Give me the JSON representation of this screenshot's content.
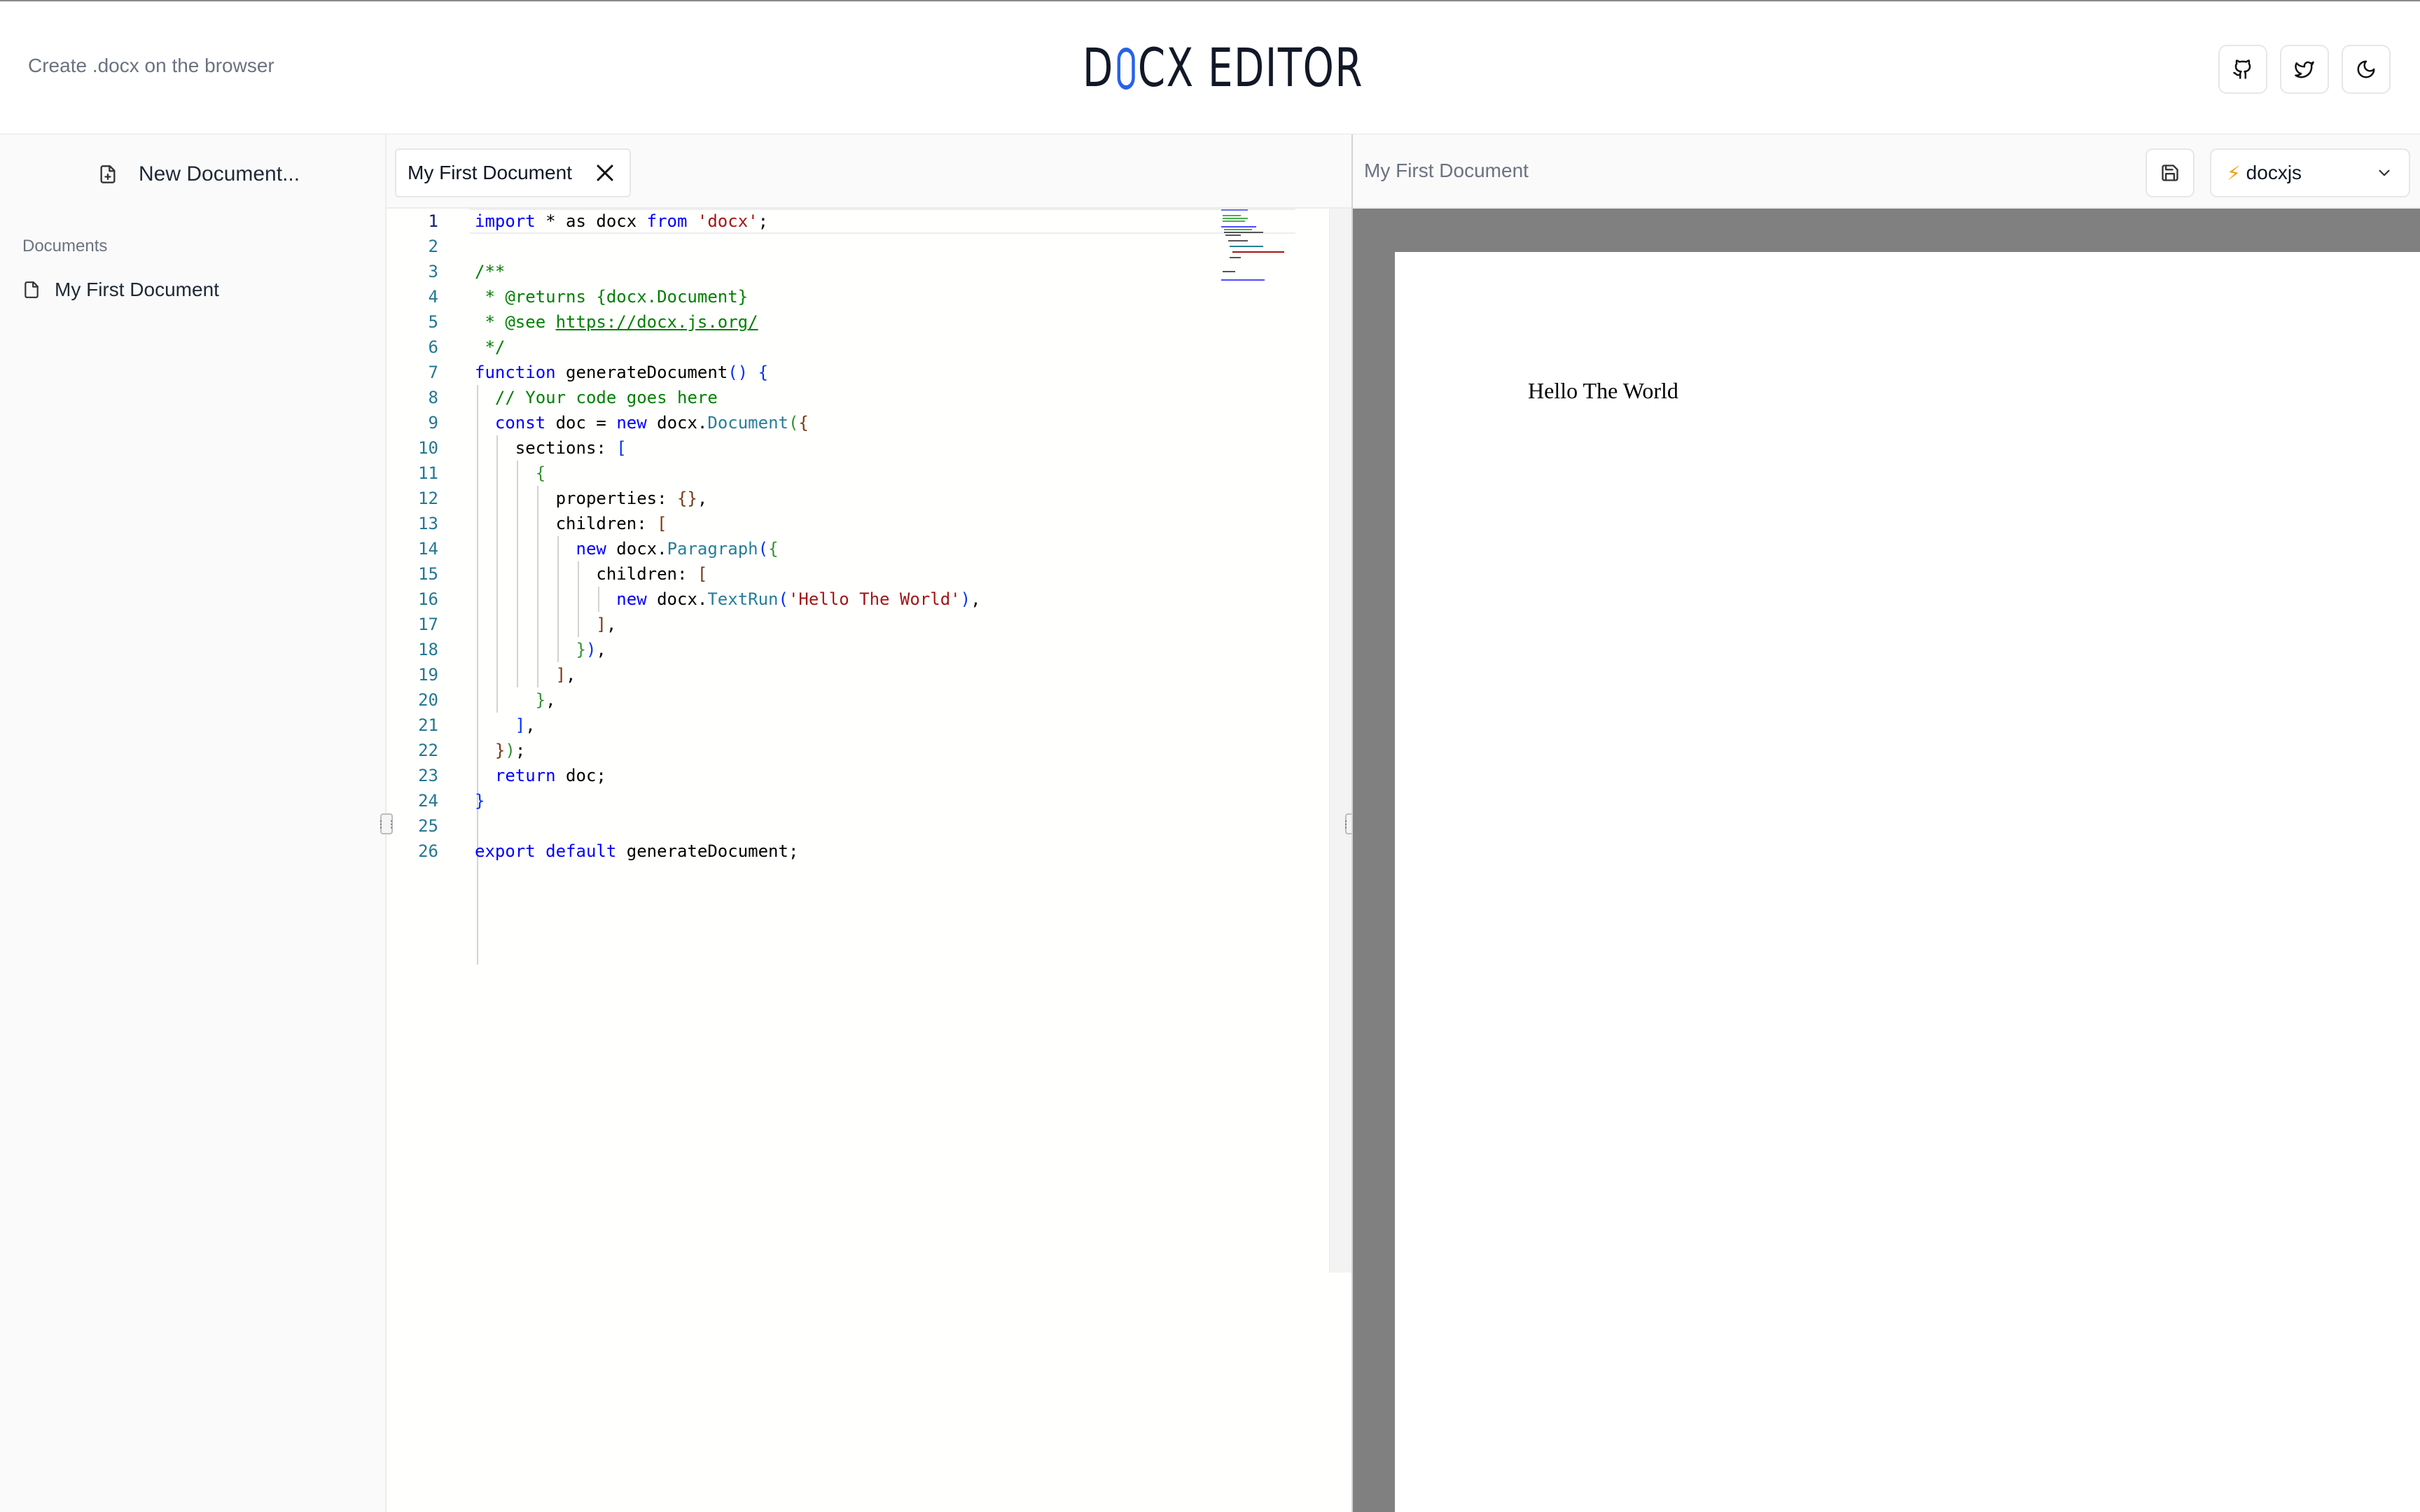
{
  "header": {
    "tagline": "Create .docx on the browser",
    "logo_left": "D",
    "logo_right": "CX EDITOR"
  },
  "sidebar": {
    "new_document_label": "New Document...",
    "documents_heading": "Documents",
    "documents": [
      {
        "title": "My First Document"
      }
    ]
  },
  "editor": {
    "tab_title": "My First Document",
    "line_numbers": [
      "1",
      "2",
      "3",
      "4",
      "5",
      "6",
      "7",
      "8",
      "9",
      "10",
      "11",
      "12",
      "13",
      "14",
      "15",
      "16",
      "17",
      "18",
      "19",
      "20",
      "21",
      "22",
      "23",
      "24",
      "25",
      "26"
    ],
    "lines": [
      "import * as docx from 'docx';",
      "",
      "/**",
      " * @returns {docx.Document}",
      " * @see https://docx.js.org/",
      " */",
      "function generateDocument() {",
      "  // Your code goes here",
      "  const doc = new docx.Document({",
      "    sections: [",
      "      {",
      "        properties: {},",
      "        children: [",
      "          new docx.Paragraph({",
      "            children: [",
      "              new docx.TextRun('Hello The World'),",
      "            ],",
      "          }),",
      "        ],",
      "      },",
      "    ],",
      "  });",
      "  return doc;",
      "}",
      "",
      "export default generateDocument;"
    ]
  },
  "preview": {
    "title": "My First Document",
    "engine": "docxjs",
    "page_text": "Hello The World"
  },
  "icons": {
    "github": "github-icon",
    "twitter": "twitter-icon",
    "theme": "moon-icon",
    "save": "save-icon",
    "file": "file-icon",
    "file_plus": "file-plus-icon"
  },
  "colors": {
    "accent": "#2563eb",
    "keyword": "#0000ff",
    "string": "#a31515",
    "comment": "#008000",
    "type": "#267f99",
    "line_number": "#237893",
    "preview_background": "#808080"
  }
}
